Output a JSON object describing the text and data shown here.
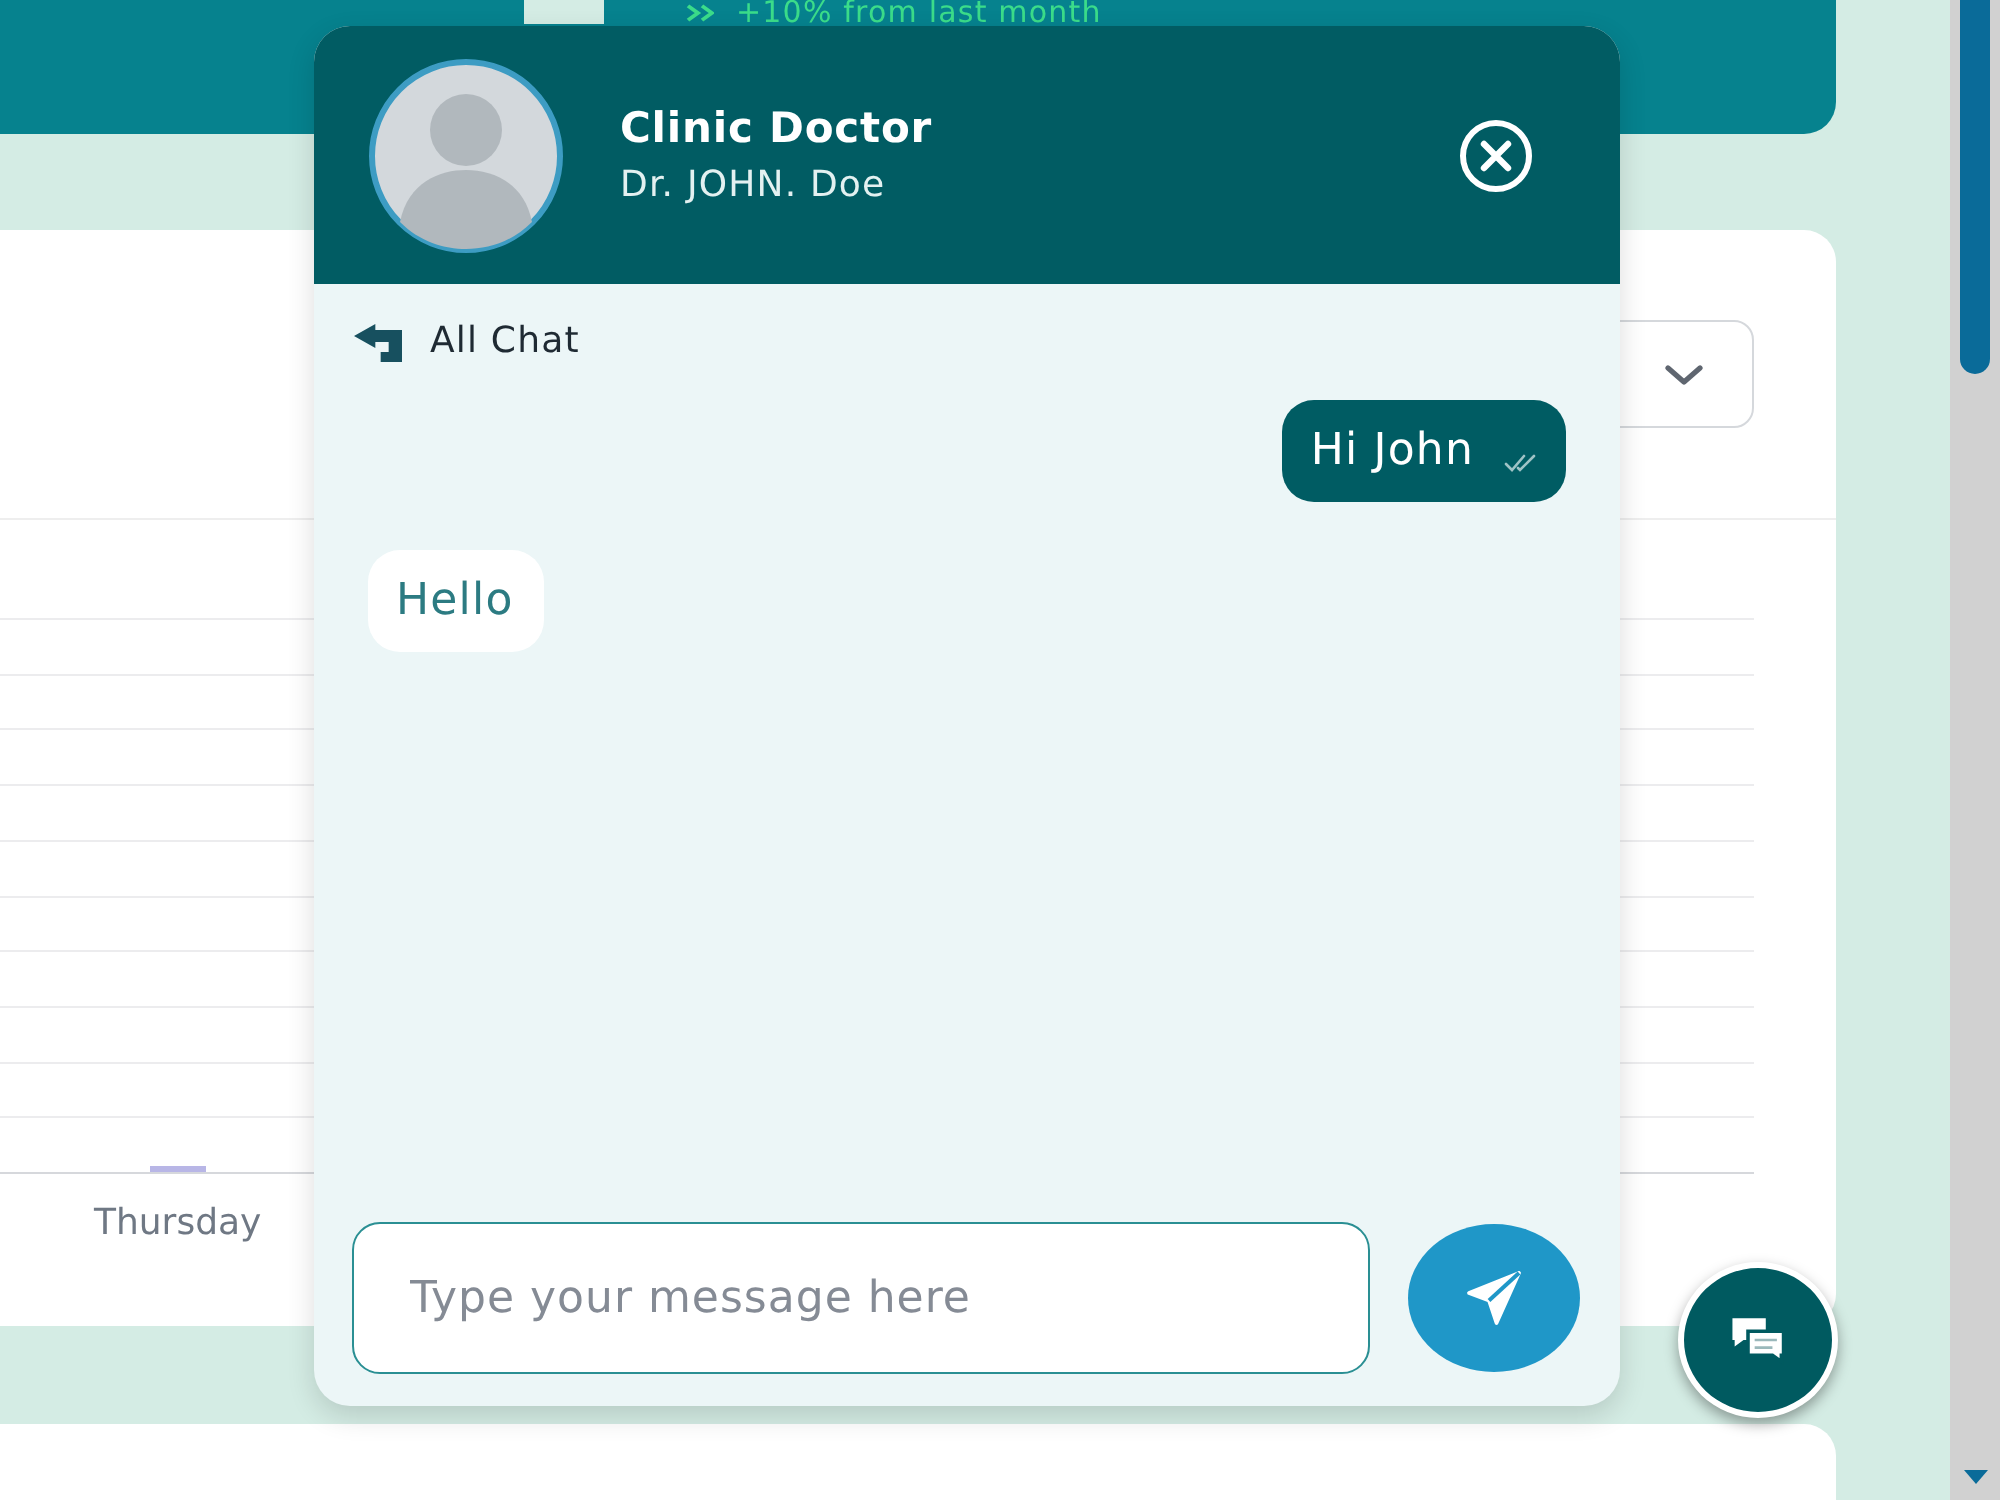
{
  "stats_card": {
    "trend": "+10% from last month"
  },
  "chart_card": {
    "axis_label": "Thursday"
  },
  "chat": {
    "title": "Clinic Doctor",
    "subtitle": "Dr. JOHN. Doe",
    "back_label": "All Chat",
    "messages": [
      {
        "kind": "sent",
        "text": "Hi John",
        "delivered": true
      },
      {
        "kind": "received",
        "text": "Hello"
      }
    ],
    "composer": {
      "placeholder": "Type your message here"
    }
  }
}
